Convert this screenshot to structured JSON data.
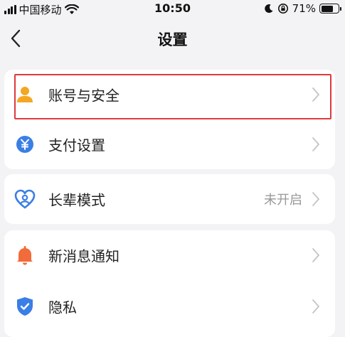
{
  "status_bar": {
    "carrier": "中国移动",
    "time": "10:50",
    "battery_percent": "71%",
    "battery_level": 0.71,
    "icons": [
      "signal-icon",
      "wifi-icon",
      "moon-icon",
      "orientation-lock-icon",
      "battery-icon"
    ]
  },
  "nav": {
    "title": "设置",
    "back_icon": "chevron-left-icon"
  },
  "groups": [
    {
      "items": [
        {
          "label": "账号与安全",
          "icon": "person-icon",
          "icon_color": "#f5a623",
          "highlighted": true
        },
        {
          "label": "支付设置",
          "icon": "yuan-icon",
          "icon_color": "#3a7ee6"
        }
      ]
    },
    {
      "items": [
        {
          "label": "长辈模式",
          "value": "未开启",
          "icon": "heart-face-icon",
          "icon_color": "#3a7ee6"
        }
      ]
    },
    {
      "items": [
        {
          "label": "新消息通知",
          "icon": "bell-icon",
          "icon_color": "#f26b3a"
        },
        {
          "label": "隐私",
          "icon": "shield-check-icon",
          "icon_color": "#3a7ee6"
        }
      ]
    }
  ],
  "colors": {
    "background": "#f3f3f5",
    "card": "#ffffff",
    "highlight_border": "#e0393e",
    "chevron": "#c4c4c4",
    "secondary_text": "#999999"
  }
}
